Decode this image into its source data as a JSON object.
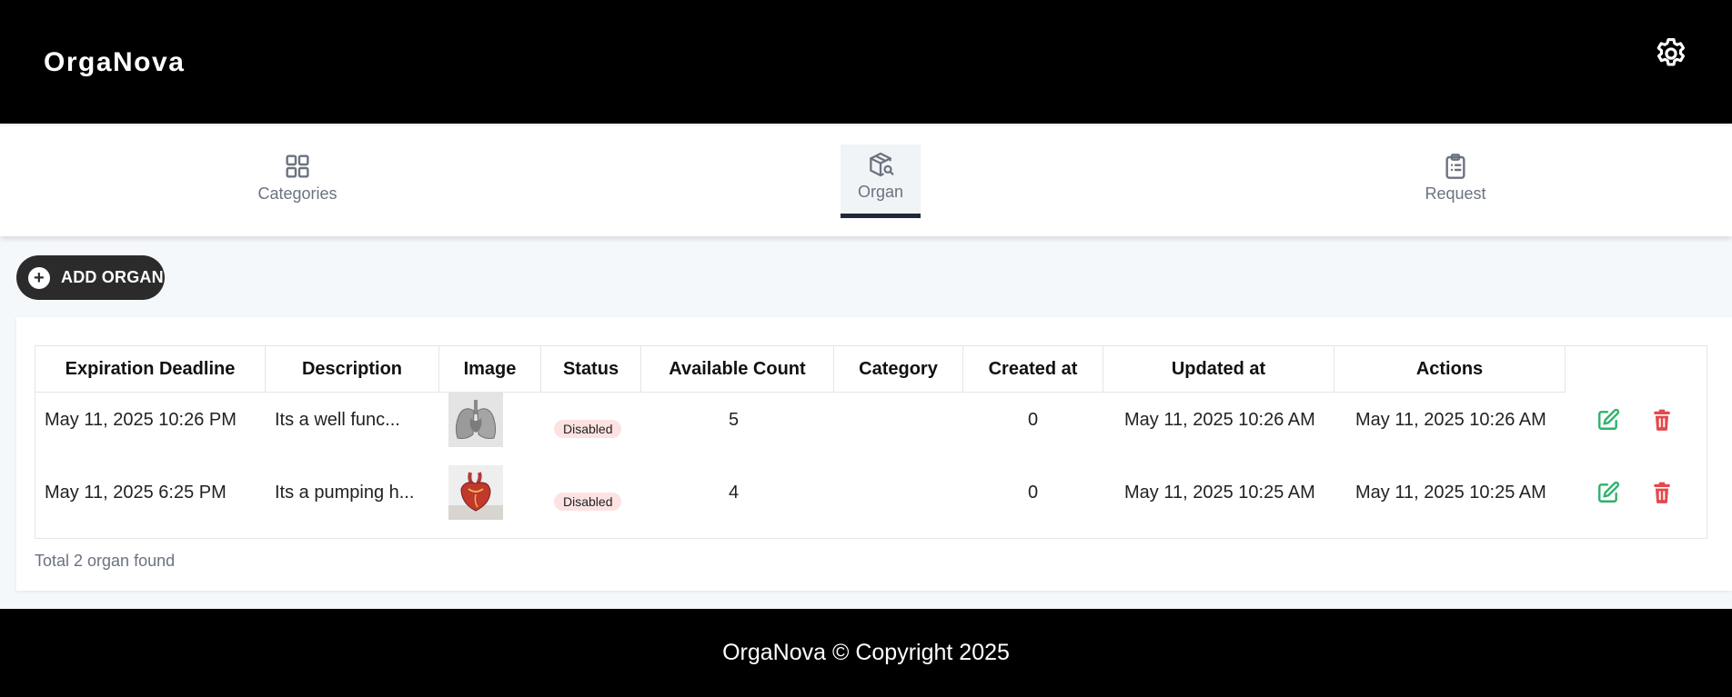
{
  "app": {
    "brand": "OrgaNova"
  },
  "header": {
    "settings_icon": "gear-icon"
  },
  "nav": {
    "tabs": [
      {
        "label": "Categories",
        "icon": "grid-icon",
        "active": false
      },
      {
        "label": "Organ",
        "icon": "package-search-icon",
        "active": true
      },
      {
        "label": "Request",
        "icon": "clipboard-icon",
        "active": false
      }
    ]
  },
  "toolbar": {
    "add_label": "ADD ORGAN",
    "add_icon": "plus-circle-icon"
  },
  "table": {
    "headers": [
      "Expiration Deadline",
      "Description",
      "Image",
      "Status",
      "Available Count",
      "Category",
      "Created at",
      "Updated at",
      "Actions"
    ],
    "rows": [
      {
        "expiration": "May 11, 2025 10:26 PM",
        "description": "Its a well func...",
        "image": "lungs-image",
        "status": "Disabled",
        "available_count": "5",
        "category": "",
        "created_at": "0",
        "updated_at": "May 11, 2025 10:26 AM",
        "actions_date": "May 11, 2025 10:26 AM"
      },
      {
        "expiration": "May 11, 2025 6:25 PM",
        "description": "Its a pumping h...",
        "image": "heart-image",
        "status": "Disabled",
        "available_count": "4",
        "category": "",
        "created_at": "0",
        "updated_at": "May 11, 2025 10:25 AM",
        "actions_date": "May 11, 2025 10:25 AM"
      }
    ],
    "footer_text": "Total 2 organ found"
  },
  "colors": {
    "edit": "#2db26b",
    "delete": "#e5484d",
    "badge_bg": "#fde2e2",
    "topbar": "#000000"
  },
  "footer": {
    "text": "OrgaNova © Copyright 2025"
  }
}
